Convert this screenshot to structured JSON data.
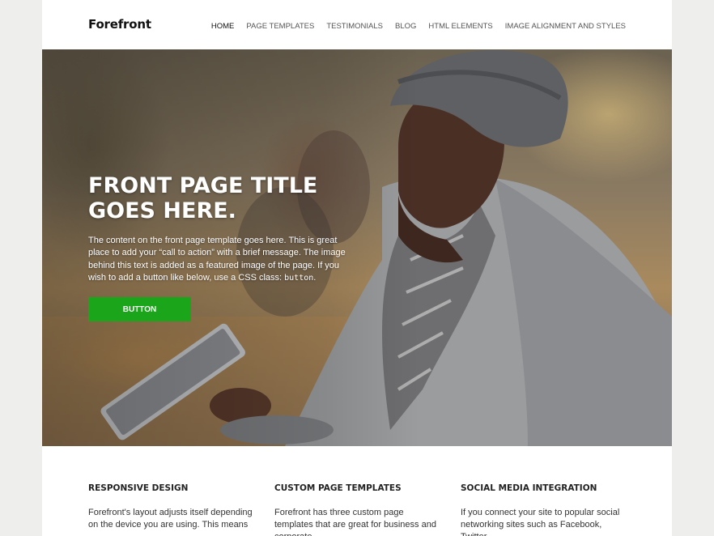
{
  "site": {
    "title": "Forefront"
  },
  "nav": {
    "items": [
      {
        "label": "Home"
      },
      {
        "label": "Page Templates"
      },
      {
        "label": "Testimonials"
      },
      {
        "label": "Blog"
      },
      {
        "label": "HTML Elements"
      },
      {
        "label": "Image Alignment and Styles"
      }
    ]
  },
  "hero": {
    "title": "Front Page Title Goes Here.",
    "text_before": "The content on the front page template goes here. This is great place to add your “call to action” with a brief message. The image behind this text is added as a featured image of the page. If you wish to add a button like below, use a CSS class: ",
    "text_code": "button",
    "text_after": ".",
    "button_label": "Button"
  },
  "features": [
    {
      "title": "Responsive Design",
      "text": "Forefront's layout adjusts itself depending on the device you are using. This means"
    },
    {
      "title": "Custom Page Templates",
      "text": "Forefront has three custom page templates that are great for business and corporate"
    },
    {
      "title": "Social Media Integration",
      "text": "If you connect your site to popular social networking sites such as Facebook, Twitter,"
    }
  ],
  "colors": {
    "accent": "#1aa51a",
    "background": "#eeefec"
  }
}
